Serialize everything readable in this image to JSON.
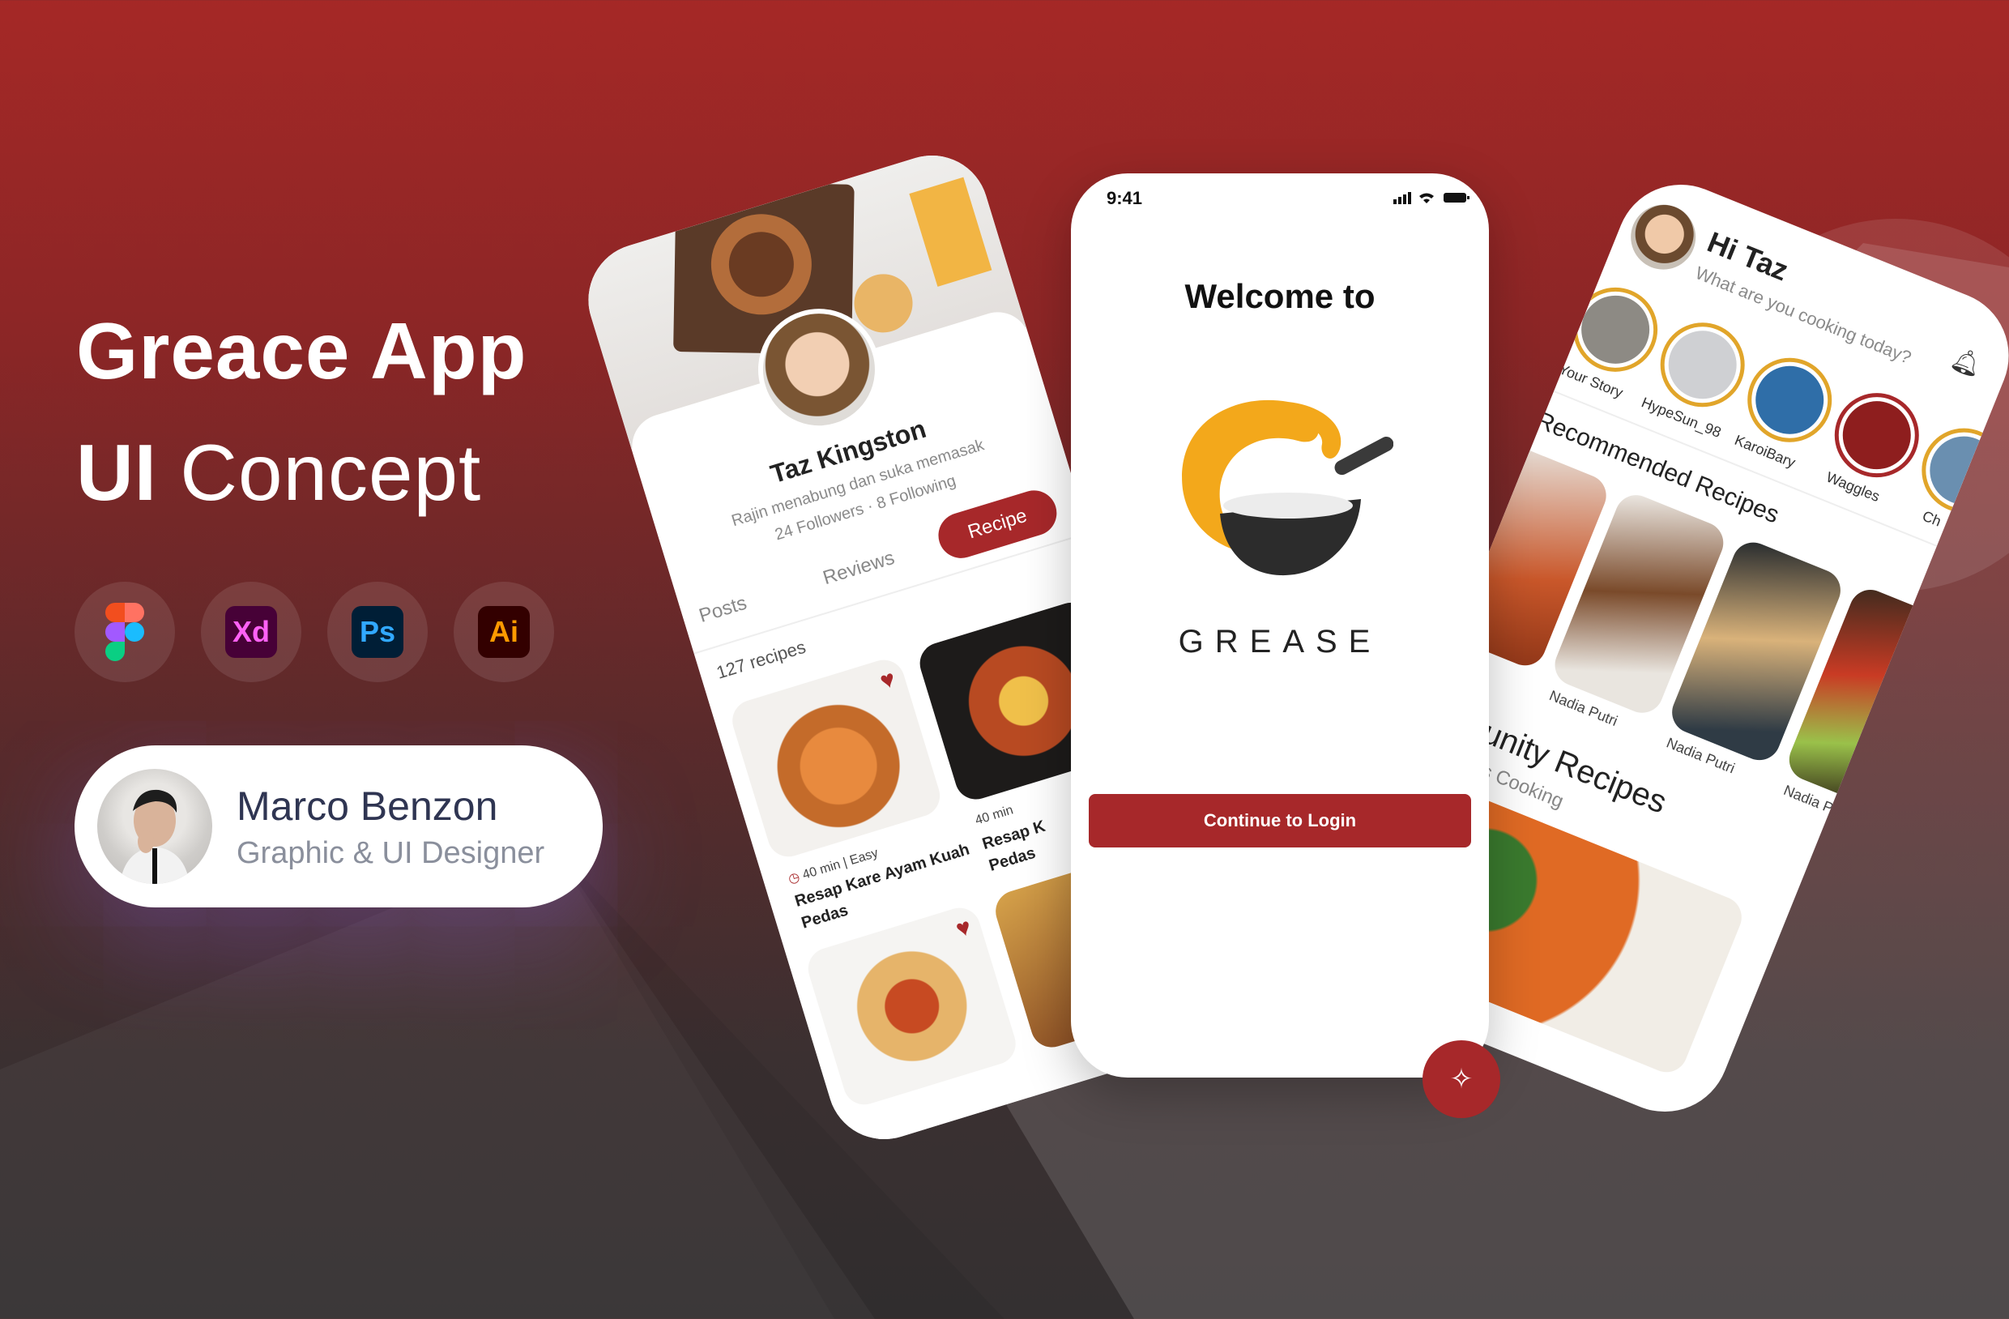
{
  "hero": {
    "title_bold": "Greace App",
    "title_line2_bold": "UI",
    "title_line2_light": "Concept"
  },
  "tools": [
    {
      "icon": "figma-icon",
      "label": ""
    },
    {
      "icon": "xd-icon",
      "label": "Xd",
      "bg": "#470137",
      "fg": "#ff61f6"
    },
    {
      "icon": "photoshop-icon",
      "label": "Ps",
      "bg": "#001e36",
      "fg": "#31a8ff"
    },
    {
      "icon": "illustrator-icon",
      "label": "Ai",
      "bg": "#330000",
      "fg": "#ff9a00"
    }
  ],
  "author": {
    "name": "Marco Benzon",
    "role": "Graphic & UI Designer"
  },
  "profile": {
    "name": "Taz Kingston",
    "bio": "Rajin menabung dan suka memasak",
    "stats": "24 Followers · 8 Following",
    "tabs": [
      "Posts",
      "Reviews",
      "Recipe"
    ],
    "count": "127 recipes",
    "recipes": [
      {
        "title": "Resap Kare Ayam Kuah",
        "title2": "Pedas",
        "time": "40 min",
        "level": "Easy"
      },
      {
        "title": "Resap K",
        "title2": "Pedas",
        "time": "40 min"
      }
    ]
  },
  "welcome": {
    "status_time": "9:41",
    "heading": "Welcome to",
    "brand": "GREASE",
    "cta": "Continue to Login"
  },
  "home": {
    "greeting": "Hi Taz",
    "subtitle": "What are you cooking today?",
    "stories": [
      "Your Story",
      "HypeSun_98",
      "KaroiBary",
      "Waggles",
      "Ch"
    ],
    "recommended_title": "Recommended Recipes",
    "recommended_authors": [
      "Nadia Putri",
      "Nadia Putri",
      "Nadia Putri"
    ],
    "community_title": "Community Recipes",
    "community_subtitle": "Community is Cooking"
  },
  "colors": {
    "accent": "#a7282a",
    "gold": "#f3a81b",
    "dark": "#222222"
  }
}
